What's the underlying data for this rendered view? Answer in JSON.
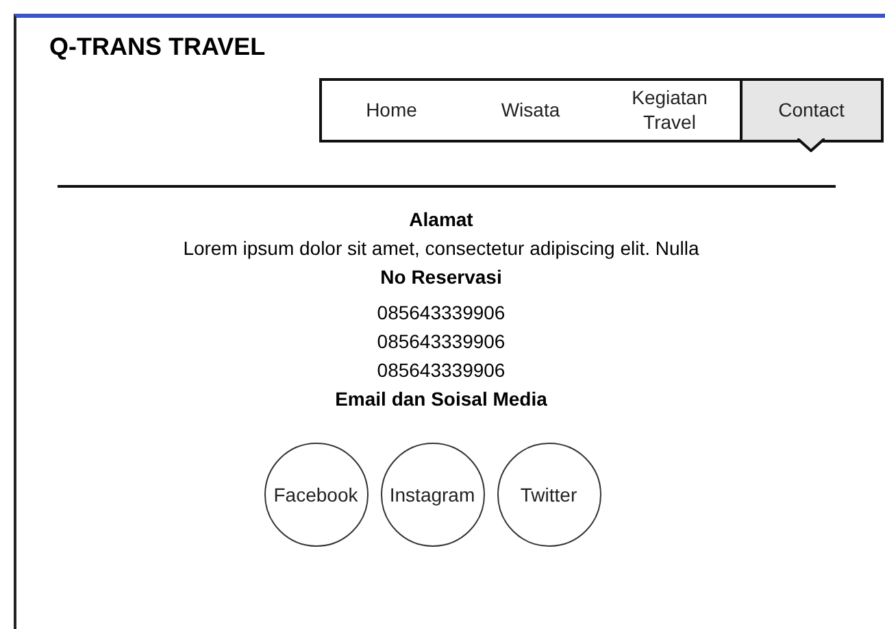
{
  "site_title": "Q-TRANS TRAVEL",
  "nav": [
    {
      "label": "Home",
      "selected": false
    },
    {
      "label": "Wisata",
      "selected": false
    },
    {
      "label": "Kegiatan Travel",
      "selected": false
    },
    {
      "label": "Contact",
      "selected": true
    }
  ],
  "sections": [
    {
      "heading": "Alamat",
      "lines": [
        "Lorem ipsum dolor sit amet, consectetur adipiscing elit. Nulla"
      ]
    },
    {
      "heading": "No Reservasi",
      "lines": [
        "085643339906",
        "085643339906",
        "085643339906"
      ]
    },
    {
      "heading": "Email dan Soisal Media"
    }
  ],
  "social_buttons": [
    "Facebook",
    "Instagram",
    "Twitter"
  ]
}
